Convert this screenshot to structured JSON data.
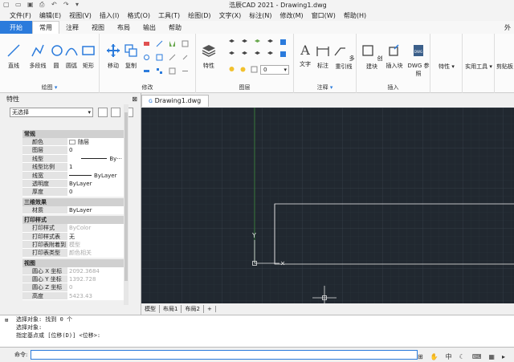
{
  "window": {
    "title": "浩辰CAD 2021 - Drawing1.dwg"
  },
  "quick_access": [
    "new-icon",
    "open-icon",
    "save-icon",
    "print-icon",
    "undo-icon",
    "redo-icon",
    "dropdown-icon"
  ],
  "menu": [
    "文件(F)",
    "编辑(E)",
    "视图(V)",
    "插入(I)",
    "格式(O)",
    "工具(T)",
    "绘图(D)",
    "文字(X)",
    "标注(N)",
    "修改(M)",
    "窗口(W)",
    "帮助(H)"
  ],
  "tabs": [
    "开始",
    "常用",
    "注释",
    "视图",
    "布局",
    "输出",
    "帮助"
  ],
  "tabs_right": "外",
  "ribbon": {
    "draw": {
      "label": "绘图",
      "buttons": [
        "直线",
        "多段线",
        "圆",
        "圆弧",
        "矩形"
      ]
    },
    "modify": {
      "label": "修改",
      "buttons": [
        "移动",
        "复制"
      ]
    },
    "layers": {
      "label": "图层",
      "button": "特性",
      "layer_value": "0"
    },
    "annotation": {
      "label": "注释",
      "buttons": [
        "文字",
        "标注",
        "多重引线"
      ]
    },
    "insert": {
      "label": "插入",
      "buttons": [
        "创建块",
        "插入块",
        "DWG 参照"
      ]
    },
    "extra": [
      "特性",
      "实用工具",
      "剪贴板"
    ]
  },
  "properties": {
    "title": "特性",
    "selection": "无选择",
    "groups": [
      {
        "name": "常规",
        "rows": [
          {
            "k": "颜色",
            "v": "随层"
          },
          {
            "k": "图层",
            "v": "0"
          },
          {
            "k": "线型",
            "v": "By···"
          },
          {
            "k": "线型比例",
            "v": "1"
          },
          {
            "k": "线宽",
            "v": "ByLayer"
          },
          {
            "k": "透明度",
            "v": "ByLayer"
          },
          {
            "k": "厚度",
            "v": "0"
          }
        ]
      },
      {
        "name": "三维效果",
        "rows": [
          {
            "k": "材质",
            "v": "ByLayer"
          }
        ]
      },
      {
        "name": "打印样式",
        "rows": [
          {
            "k": "打印样式",
            "v": "ByColor",
            "dis": true
          },
          {
            "k": "打印样式表",
            "v": "无"
          },
          {
            "k": "打印表附着到",
            "v": "模型",
            "dis": true
          },
          {
            "k": "打印表类型",
            "v": "颜色相关",
            "dis": true
          }
        ]
      },
      {
        "name": "视图",
        "rows": [
          {
            "k": "圆心 X 坐标",
            "v": "2092.3684",
            "dis": true
          },
          {
            "k": "圆心 Y 坐标",
            "v": "1392.728",
            "dis": true
          },
          {
            "k": "圆心 Z 坐标",
            "v": "0",
            "dis": true
          },
          {
            "k": "高度",
            "v": "5423.43",
            "dis": true
          }
        ]
      }
    ]
  },
  "document": {
    "tab": "Drawing1.dwg",
    "ucs_label": "Y"
  },
  "layout_tabs": [
    "模型",
    "布局1",
    "布局2",
    "+"
  ],
  "command_history": [
    "选择对象: 找到 0 个",
    "选择对象:",
    "指定基点或 [位移(D)] <位移>:"
  ],
  "command_prompt": "命令:",
  "colors": {
    "accent": "#2b7bdc",
    "canvas": "#212830",
    "grid": "#2f3640"
  }
}
